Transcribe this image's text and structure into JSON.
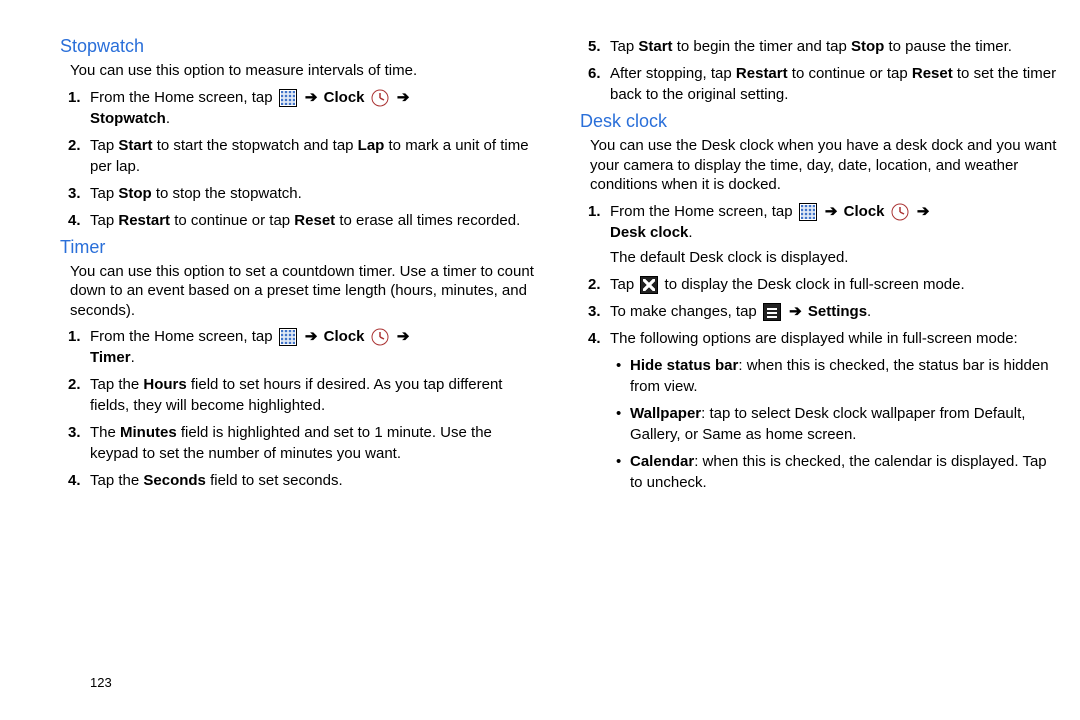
{
  "page_number": "123",
  "arrow_glyph": "➔",
  "left": {
    "stopwatch": {
      "heading": "Stopwatch",
      "intro": "You can use this option to measure intervals of time.",
      "steps": {
        "s1a": "From the Home screen, tap ",
        "s1b": " Clock ",
        "s1c": "Stopwatch",
        "s2a": "Tap ",
        "s2b": "Start",
        "s2c": " to start the stopwatch and tap ",
        "s2d": "Lap",
        "s2e": " to mark a unit of time per lap.",
        "s3a": "Tap ",
        "s3b": "Stop",
        "s3c": " to stop the stopwatch.",
        "s4a": "Tap ",
        "s4b": "Restart",
        "s4c": " to continue or tap ",
        "s4d": "Reset",
        "s4e": " to erase all times recorded."
      }
    },
    "timer": {
      "heading": "Timer",
      "intro": "You can use this option to set a countdown timer. Use a timer to count down to an event based on a preset time length (hours, minutes, and seconds).",
      "steps": {
        "s1a": "From the Home screen, tap ",
        "s1b": " Clock ",
        "s1c": "Timer",
        "s2a": "Tap the ",
        "s2b": "Hours",
        "s2c": " field to set hours if desired. As you tap different fields, they will become highlighted.",
        "s3a": "The ",
        "s3b": "Minutes",
        "s3c": " field is highlighted and set to 1 minute. Use the keypad to set the number of minutes you want.",
        "s4a": "Tap the ",
        "s4b": "Seconds",
        "s4c": " field to set seconds."
      }
    }
  },
  "right": {
    "timer_cont": {
      "s5a": "Tap ",
      "s5b": "Start",
      "s5c": " to begin the timer and tap ",
      "s5d": "Stop",
      "s5e": " to pause the timer.",
      "s6a": "After stopping, tap ",
      "s6b": "Restart",
      "s6c": " to continue or tap ",
      "s6d": "Reset",
      "s6e": " to set the timer back to the original setting."
    },
    "desk": {
      "heading": "Desk clock",
      "intro": "You can use the Desk clock when you have a desk dock and you want your camera to display the time, day, date, location, and weather conditions when it is docked.",
      "s1a": "From the Home screen, tap ",
      "s1b": " Clock ",
      "s1c": "Desk clock",
      "s1_after": "The default Desk clock is displayed.",
      "s2a": "Tap ",
      "s2b": " to display the Desk clock in full-screen mode.",
      "s3a": "To make changes, tap ",
      "s3b": " Settings",
      "s4": "The following options are displayed while in full-screen mode:",
      "b1a": "Hide status bar",
      "b1b": ": when this is checked, the status bar is hidden from view.",
      "b2a": "Wallpaper",
      "b2b": ": tap to select Desk clock wallpaper from Default, Gallery, or Same as home screen.",
      "b3a": "Calendar",
      "b3b": ": when this is checked, the calendar is displayed. Tap to uncheck."
    }
  }
}
